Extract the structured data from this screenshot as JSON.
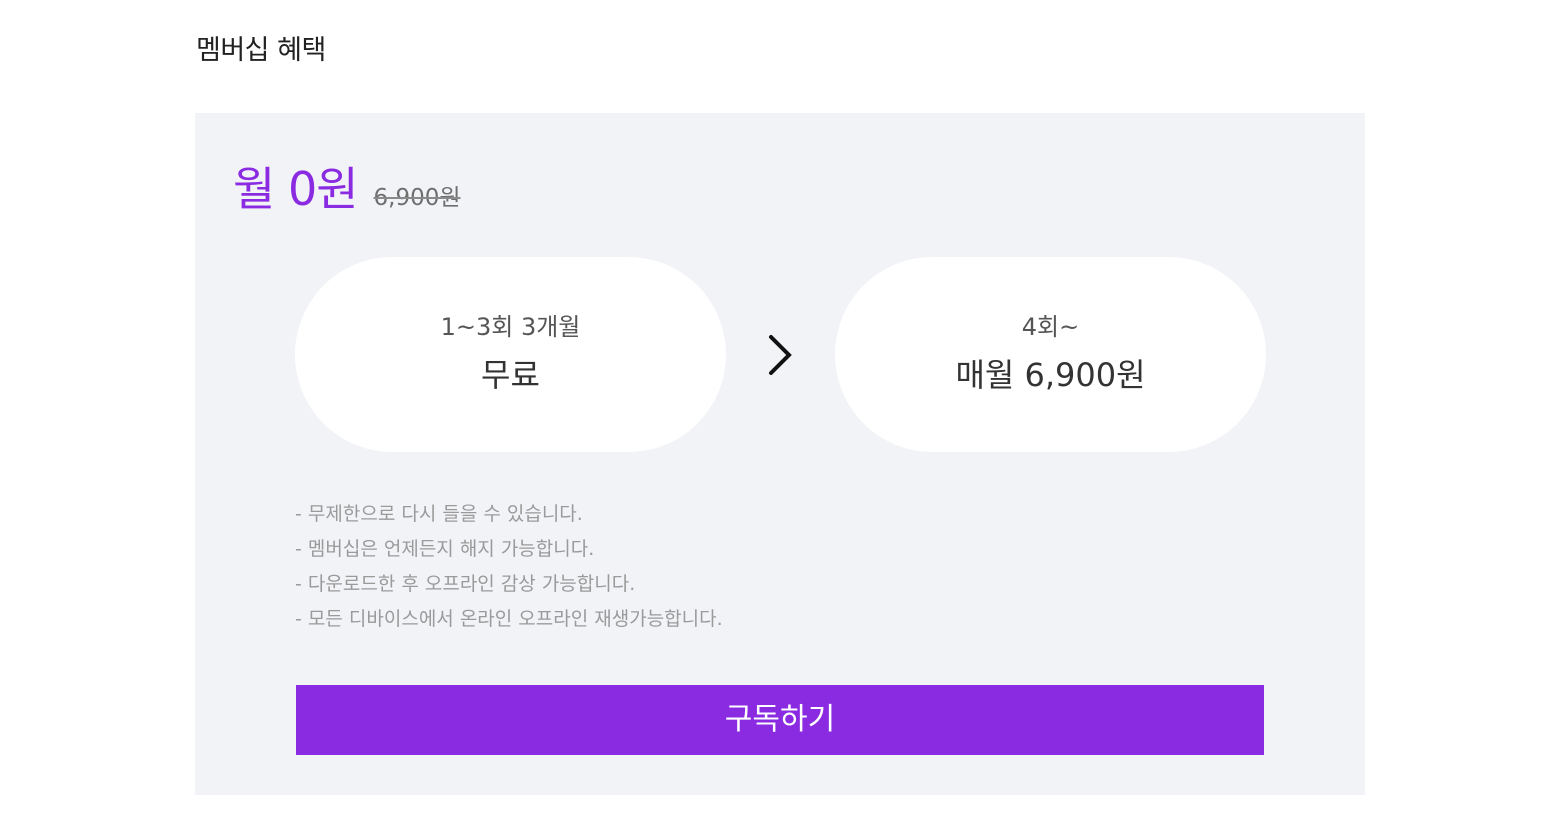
{
  "section_title": "멤버십 혜택",
  "price": {
    "current": "월 0원",
    "original": "6,900원"
  },
  "plans": [
    {
      "subtitle": "1~3회 3개월",
      "label": "무료"
    },
    {
      "subtitle": "4회~",
      "label": "매월 6,900원"
    }
  ],
  "icons": {
    "arrow": "chevron-right-icon"
  },
  "benefits": [
    "- 무제한으로 다시 들을 수 있습니다.",
    "- 멤버십은 언제든지 해지 가능합니다.",
    "- 다운로드한 후 오프라인 감상 가능합니다.",
    "- 모든 디바이스에서 온라인 오프라인 재생가능합니다."
  ],
  "subscribe_button": "구독하기",
  "colors": {
    "accent": "#8a2be2",
    "card_background": "#f2f3f7"
  }
}
